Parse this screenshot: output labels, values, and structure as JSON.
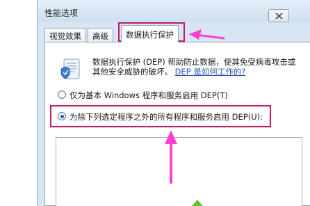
{
  "window": {
    "title": "性能选项",
    "close_icon": "close-icon"
  },
  "tabs": [
    {
      "label": "视觉效果",
      "active": false
    },
    {
      "label": "高级",
      "active": false
    },
    {
      "label": "数据执行保护",
      "active": true
    }
  ],
  "dep": {
    "icon": "dep-shield-document-icon",
    "description": "数据执行保护 (DEP) 帮助防止数据，使其免受病毒攻击或其他安全威胁的破坏。",
    "link": "DEP 是如何工作的?"
  },
  "options": [
    {
      "label": "仅为基本 Windows 程序和服务启用 DEP(T)",
      "checked": false
    },
    {
      "label": "为除下列选定程序之外的所有程序和服务启用 DEP(U):",
      "checked": true
    }
  ],
  "annotation_color": "#c4186b",
  "accent_color": "#ff3fd1"
}
